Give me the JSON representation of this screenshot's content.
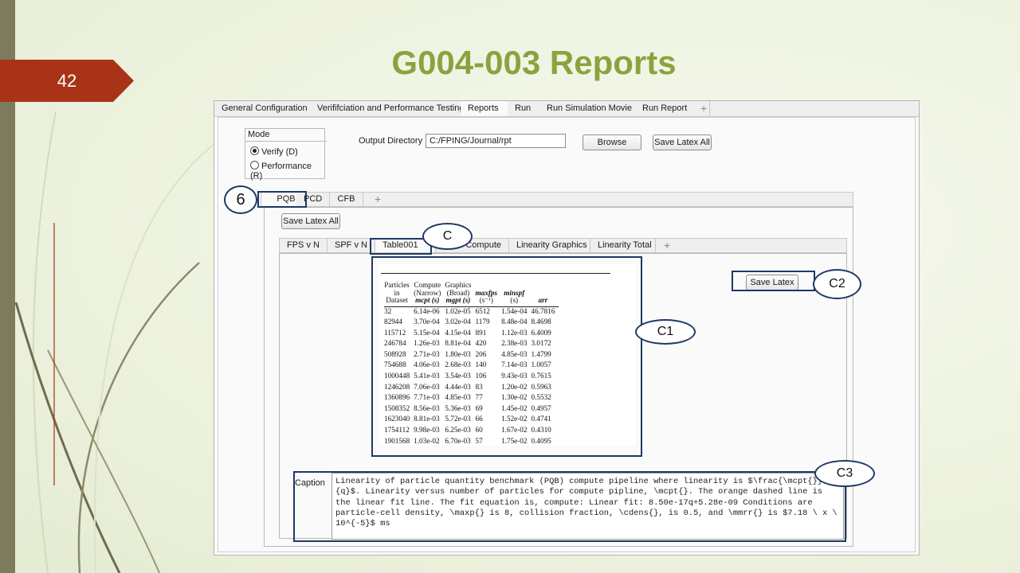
{
  "slide": {
    "number": "42",
    "title": "G004-003 Reports"
  },
  "colors": {
    "title": "#8aa33e",
    "slide_number_bg": "#a83317",
    "callout_border": "#1f3864"
  },
  "top_tabs": [
    "General Configuration",
    "Verififciation and Performance Testing",
    "Reports",
    "Run",
    "Run Simulation Movie",
    "Run Report"
  ],
  "top_tabs_active": "Reports",
  "mode": {
    "label": "Mode",
    "options": [
      "Verify (D)",
      "Performance (R)"
    ],
    "selected": "Verify (D)"
  },
  "output": {
    "label": "Output Directory",
    "value": "C:/FPING/Journal/rpt",
    "browse": "Browse",
    "save_all": "Save Latex All"
  },
  "sub_tabs": [
    "PQB",
    "PCD",
    "CFB"
  ],
  "sub_save_all": "Save Latex All",
  "inner_tabs": [
    "FPS v N",
    "SPF v N",
    "Table001",
    "Compute",
    "Linearity Graphics",
    "Linearity Total"
  ],
  "inner_tabs_active": "Table001",
  "save_latex": "Save Latex",
  "caption": {
    "label": "Caption",
    "text": "Linearity of particle quantity benchmark (PQB) compute pipeline where linearity is $\\frac{\\mcpt{}}{q}$. Linearity versus number of particles for compute pipline, \\mcpt{}. The orange dashed line is the linear fit line. The fit equation is, compute: Linear fit: 8.50e-17q+5.28e-09 Conditions are particle-cell density, \\maxp{} is 8, collision fraction, \\cdens{}, is 0.5, and \\mmrr{} is $7.18 \\ x \\ 10^{-5}$ ms"
  },
  "callouts": {
    "six": "6",
    "c": "C",
    "c1": "C1",
    "c2": "C2",
    "c3": "C3"
  },
  "table": {
    "headers": [
      [
        "Particles",
        "in",
        "Dataset"
      ],
      [
        "Compute",
        "(Narrow)",
        "mcpt (s)"
      ],
      [
        "Graphics",
        "(Broad)",
        "mgpt (s)"
      ],
      [
        "maxfps",
        "(s⁻¹)"
      ],
      [
        "minspf",
        "(s)"
      ],
      [
        "arr"
      ]
    ],
    "rows": [
      [
        "32",
        "6.14e-06",
        "1.02e-05",
        "6512",
        "1.54e-04",
        "46.7816"
      ],
      [
        "82944",
        "3.70e-04",
        "3.02e-04",
        "1179",
        "8.48e-04",
        "8.4698"
      ],
      [
        "115712",
        "5.15e-04",
        "4.15e-04",
        "891",
        "1.12e-03",
        "6.4009"
      ],
      [
        "246784",
        "1.26e-03",
        "8.81e-04",
        "420",
        "2.38e-03",
        "3.0172"
      ],
      [
        "508928",
        "2.71e-03",
        "1.80e-03",
        "206",
        "4.85e-03",
        "1.4799"
      ],
      [
        "754688",
        "4.06e-03",
        "2.68e-03",
        "140",
        "7.14e-03",
        "1.0057"
      ],
      [
        "1000448",
        "5.41e-03",
        "3.54e-03",
        "106",
        "9.43e-03",
        "0.7615"
      ],
      [
        "1246208",
        "7.06e-03",
        "4.44e-03",
        "83",
        "1.20e-02",
        "0.5963"
      ],
      [
        "1360896",
        "7.71e-03",
        "4.85e-03",
        "77",
        "1.30e-02",
        "0.5532"
      ],
      [
        "1508352",
        "8.56e-03",
        "5.36e-03",
        "69",
        "1.45e-02",
        "0.4957"
      ],
      [
        "1623040",
        "8.81e-03",
        "5.72e-03",
        "66",
        "1.52e-02",
        "0.4741"
      ],
      [
        "1754112",
        "9.98e-03",
        "6.25e-03",
        "60",
        "1.67e-02",
        "0.4310"
      ],
      [
        "1901568",
        "1.03e-02",
        "6.70e-03",
        "57",
        "1.75e-02",
        "0.4095"
      ]
    ]
  }
}
